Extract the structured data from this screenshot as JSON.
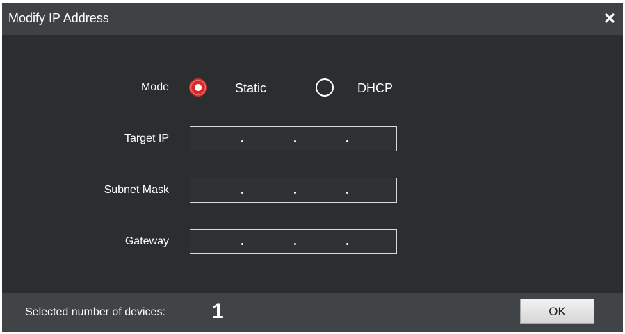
{
  "dialog": {
    "title": "Modify IP Address",
    "close_icon": "close-icon"
  },
  "mode": {
    "label": "Mode",
    "options": [
      {
        "label": "Static",
        "selected": true
      },
      {
        "label": "DHCP",
        "selected": false
      }
    ]
  },
  "fields": {
    "target_ip": {
      "label": "Target IP",
      "value": [
        "",
        "",
        "",
        ""
      ]
    },
    "subnet_mask": {
      "label": "Subnet Mask",
      "value": [
        "",
        "",
        "",
        ""
      ]
    },
    "gateway": {
      "label": "Gateway",
      "value": [
        "",
        "",
        "",
        ""
      ]
    }
  },
  "footer": {
    "selected_label": "Selected number of devices:",
    "selected_count": "1",
    "ok_label": "OK"
  },
  "colors": {
    "accent_red": "#d42a2a",
    "title_bar": "#3f4245",
    "body_bg": "#2b2d2f",
    "footer_bg": "#414446"
  }
}
